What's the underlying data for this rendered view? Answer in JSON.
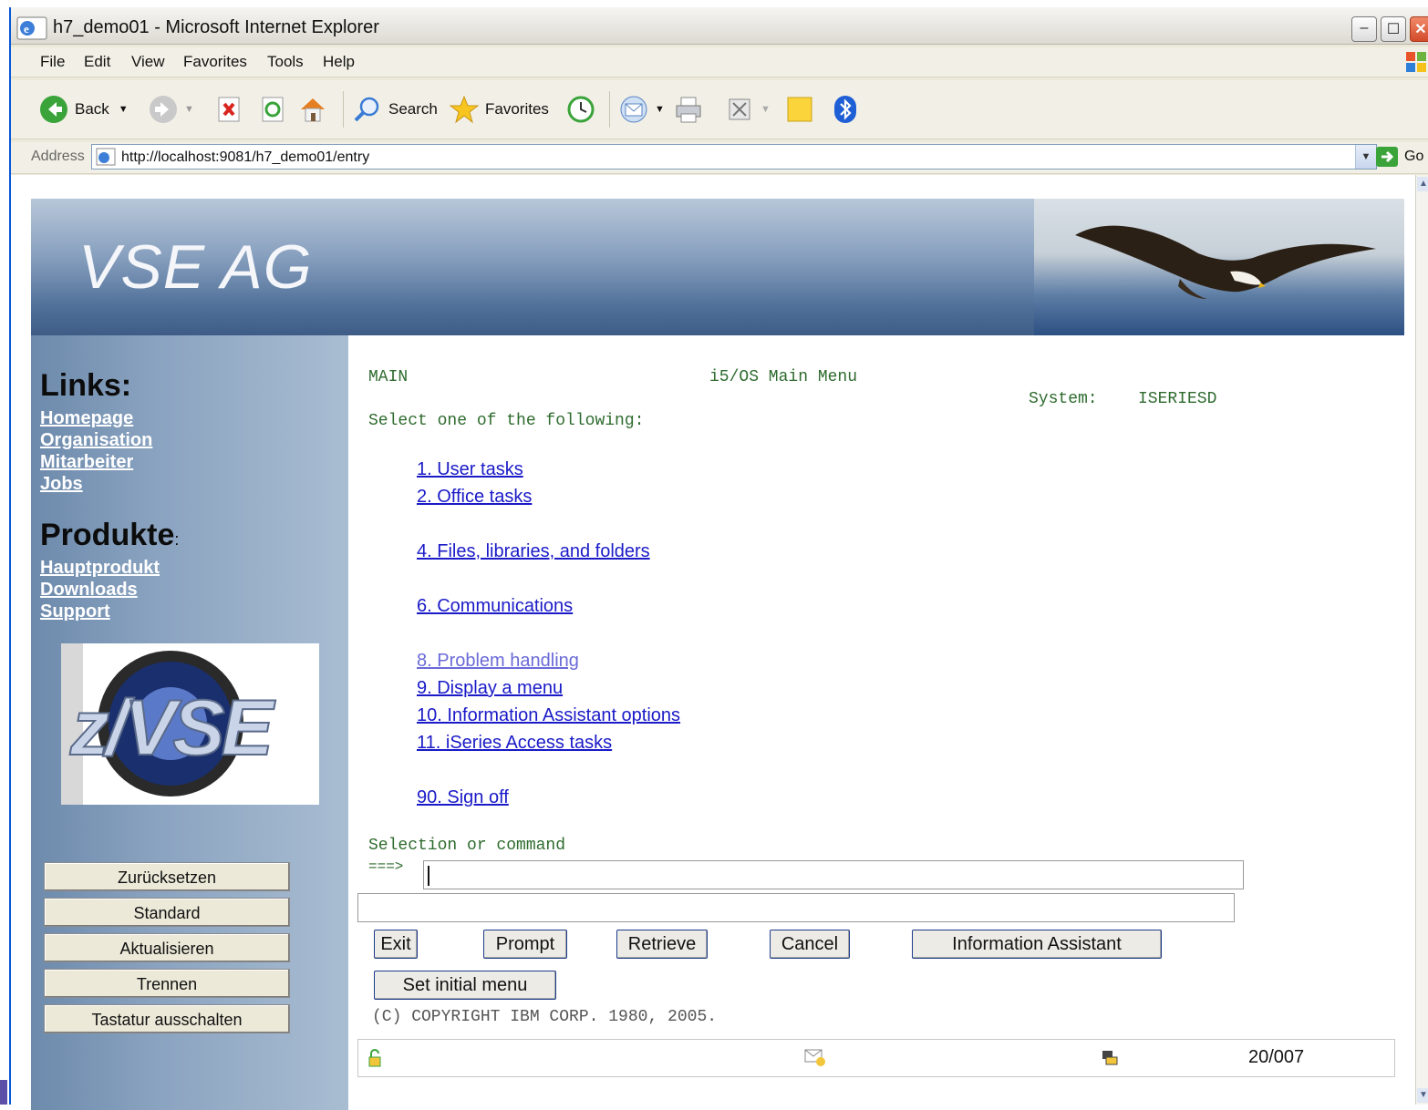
{
  "window": {
    "title": "h7_demo01 - Microsoft Internet Explorer",
    "buttons": {
      "minimize": "–",
      "maximize": "☐",
      "close": "✕"
    }
  },
  "menubar": {
    "items": [
      "File",
      "Edit",
      "View",
      "Favorites",
      "Tools",
      "Help"
    ]
  },
  "toolbar": {
    "back": "Back",
    "search": "Search",
    "favorites": "Favorites"
  },
  "address": {
    "label": "Address",
    "url": "http://localhost:9081/h7_demo01/entry",
    "go": "Go"
  },
  "banner": {
    "brand": "VSE AG"
  },
  "sidebar": {
    "links_heading": "Links:",
    "links": [
      "Homepage",
      "Organisation",
      "Mitarbeiter",
      "Jobs"
    ],
    "products_heading": "Produkte",
    "products_colon": ":",
    "products": [
      "Hauptprodukt",
      "Downloads",
      "Support"
    ],
    "logo_text": "z/VSE",
    "buttons": [
      "Zurücksetzen",
      "Standard",
      "Aktualisieren",
      "Trennen",
      "Tastatur ausschalten"
    ]
  },
  "screen": {
    "menu_id": "MAIN",
    "menu_title": "i5/OS Main Menu",
    "system_label": "System:",
    "system_name": "ISERIESD",
    "prompt": "Select one of the following:",
    "options": [
      "1. User tasks",
      "2. Office tasks",
      "4. Files, libraries, and folders",
      "6. Communications",
      "8. Problem handling",
      "9. Display a menu",
      "10. Information Assistant options",
      "11. iSeries Access tasks",
      "90. Sign off"
    ],
    "selection_label": "Selection or command",
    "arrow": "===>",
    "command_value": "",
    "function_buttons": [
      "Exit",
      "Prompt",
      "Retrieve",
      "Cancel",
      "Information Assistant",
      "Set initial menu"
    ],
    "copyright": "(C) COPYRIGHT IBM CORP. 1980, 2005.",
    "cursor_position": "20/007"
  },
  "colors": {
    "link": "#1a1ac8",
    "visited_link": "#6a6ad8",
    "terminal_text": "#2e6b2e",
    "title_bar": "#0a57d8"
  }
}
